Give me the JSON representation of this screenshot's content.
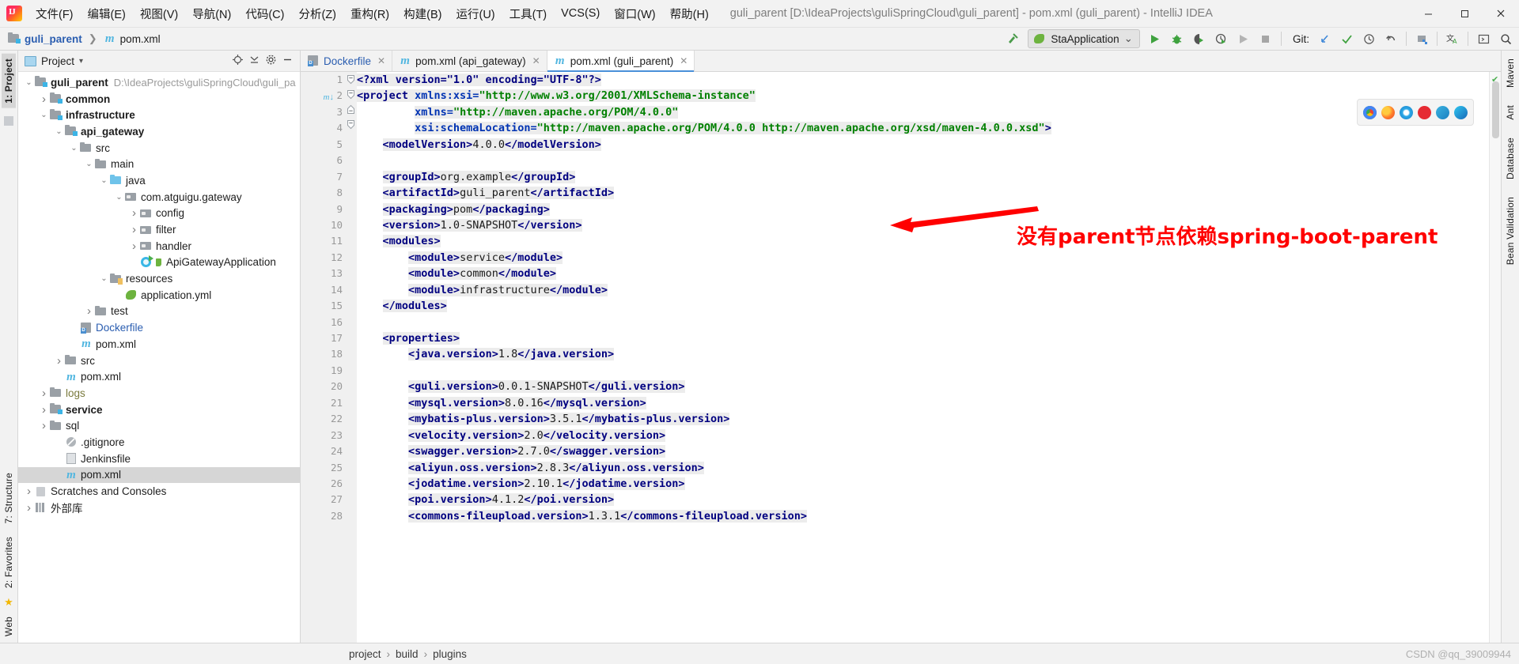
{
  "titlebar": {
    "logo_icon": "intellij-logo-icon",
    "menu": [
      {
        "label": "文件(F)"
      },
      {
        "label": "编辑(E)"
      },
      {
        "label": "视图(V)"
      },
      {
        "label": "导航(N)"
      },
      {
        "label": "代码(C)"
      },
      {
        "label": "分析(Z)"
      },
      {
        "label": "重构(R)"
      },
      {
        "label": "构建(B)"
      },
      {
        "label": "运行(U)"
      },
      {
        "label": "工具(T)"
      },
      {
        "label": "VCS(S)"
      },
      {
        "label": "窗口(W)"
      },
      {
        "label": "帮助(H)"
      }
    ],
    "window_title": "guli_parent [D:\\IdeaProjects\\guliSpringCloud\\guli_parent] - pom.xml (guli_parent) - IntelliJ IDEA",
    "minimize": "–",
    "maximize": "▢",
    "close": "✕"
  },
  "toolbar": {
    "breadcrumb_project": "guli_parent",
    "breadcrumb_sep": "❯",
    "breadcrumb_file": "pom.xml",
    "build_icon": "hammer-icon",
    "run_config": "StaApplication",
    "run_config_caret": "⌄",
    "run_icon": "run-icon",
    "debug_icon": "debug-icon",
    "run_coverage_icon": "run-with-coverage-icon",
    "profile_icon": "profiler-icon",
    "rerun_icon": "rerun-icon",
    "stop_icon": "stop-icon",
    "git_label": "Git:",
    "git_update_icon": "update-project-icon",
    "git_commit_icon": "commit-icon",
    "git_history_icon": "history-icon",
    "git_rollback_icon": "rollback-icon",
    "structure_icon": "select-in-icon",
    "translate_icon": "translate-icon",
    "terminal_icon": "terminal-icon",
    "search_icon": "search-everywhere-icon"
  },
  "left_strip": {
    "top_tabs": [
      {
        "label": "1: Project",
        "selected": true
      }
    ],
    "bottom_tabs": [
      {
        "label": "7: Structure"
      },
      {
        "label": "2: Favorites"
      }
    ],
    "web_tab": "Web",
    "star_icon": "favorites-star-icon"
  },
  "right_strip": {
    "tabs": [
      {
        "label": "Maven"
      },
      {
        "label": "Ant"
      },
      {
        "label": "Database"
      },
      {
        "label": "Bean Validation"
      }
    ]
  },
  "project_panel": {
    "header_title": "Project",
    "header_caret": "▾",
    "locate_icon": "locate-file-icon",
    "collapse_icon": "collapse-all-icon",
    "settings_icon": "gear-icon",
    "hide_icon": "hide-panel-icon",
    "tree": [
      {
        "label": "guli_parent",
        "sub": "D:\\IdeaProjects\\guliSpringCloud\\guli_pa",
        "indent": 0,
        "arrow": "▾",
        "icon": "module-icon",
        "bold": true
      },
      {
        "label": "common",
        "indent": 1,
        "arrow": "▸",
        "icon": "module-icon",
        "bold": true
      },
      {
        "label": "infrastructure",
        "indent": 1,
        "arrow": "▾",
        "icon": "module-icon",
        "bold": true
      },
      {
        "label": "api_gateway",
        "indent": 2,
        "arrow": "▾",
        "icon": "module-icon",
        "bold": true
      },
      {
        "label": "src",
        "indent": 3,
        "arrow": "▾",
        "icon": "folder-icon"
      },
      {
        "label": "main",
        "indent": 4,
        "arrow": "▾",
        "icon": "folder-icon"
      },
      {
        "label": "java",
        "indent": 5,
        "arrow": "▾",
        "icon": "source-root-icon"
      },
      {
        "label": "com.atguigu.gateway",
        "indent": 6,
        "arrow": "▾",
        "icon": "package-icon"
      },
      {
        "label": "config",
        "indent": 7,
        "arrow": "▸",
        "icon": "package-icon"
      },
      {
        "label": "filter",
        "indent": 7,
        "arrow": "▸",
        "icon": "package-icon"
      },
      {
        "label": "handler",
        "indent": 7,
        "arrow": "▸",
        "icon": "package-icon"
      },
      {
        "label": "ApiGatewayApplication",
        "indent": 7,
        "arrow": "",
        "icon": "spring-boot-class-icon"
      },
      {
        "label": "resources",
        "indent": 5,
        "arrow": "▾",
        "icon": "resources-root-icon"
      },
      {
        "label": "application.yml",
        "indent": 6,
        "arrow": "",
        "icon": "spring-yaml-icon"
      },
      {
        "label": "test",
        "indent": 4,
        "arrow": "▸",
        "icon": "folder-icon"
      },
      {
        "label": "Dockerfile",
        "indent": 3,
        "arrow": "",
        "icon": "dockerfile-icon",
        "link": true
      },
      {
        "label": "pom.xml",
        "indent": 3,
        "arrow": "",
        "icon": "maven-icon"
      },
      {
        "label": "src",
        "indent": 2,
        "arrow": "▸",
        "icon": "folder-icon"
      },
      {
        "label": "pom.xml",
        "indent": 2,
        "arrow": "",
        "icon": "maven-icon"
      },
      {
        "label": "logs",
        "indent": 1,
        "arrow": "▸",
        "icon": "folder-icon",
        "olive": true
      },
      {
        "label": "service",
        "indent": 1,
        "arrow": "▸",
        "icon": "module-icon",
        "bold": true
      },
      {
        "label": "sql",
        "indent": 1,
        "arrow": "▸",
        "icon": "folder-icon"
      },
      {
        "label": ".gitignore",
        "indent": 2,
        "arrow": "",
        "icon": "gitignore-icon"
      },
      {
        "label": "Jenkinsfile",
        "indent": 2,
        "arrow": "",
        "icon": "file-icon"
      },
      {
        "label": "pom.xml",
        "indent": 2,
        "arrow": "",
        "icon": "maven-icon",
        "selected": true
      },
      {
        "label": "Scratches and Consoles",
        "indent": 0,
        "arrow": "▸",
        "icon": "scratches-icon"
      },
      {
        "label": "外部库",
        "indent": 0,
        "arrow": "▸",
        "icon": "library-icon"
      }
    ]
  },
  "editor": {
    "tabs": [
      {
        "label": "Dockerfile",
        "icon": "dockerfile-icon",
        "close": "✕",
        "active": false,
        "link": true
      },
      {
        "label": "pom.xml (api_gateway)",
        "icon": "maven-icon",
        "close": "✕",
        "active": false
      },
      {
        "label": "pom.xml (guli_parent)",
        "icon": "maven-icon",
        "close": "✕",
        "active": true
      }
    ],
    "first_line": 1,
    "lines": [
      {
        "n": 1,
        "fold": "",
        "mark": "",
        "segs": [
          {
            "t": "<?xml version=\"1.0\" encoding=\"UTF-8\"?>",
            "c": "pi",
            "hl": true
          }
        ]
      },
      {
        "n": 2,
        "fold": "open",
        "mark": "m↓",
        "segs": [
          {
            "t": "<project ",
            "c": "tag"
          },
          {
            "t": "xmlns:xsi=",
            "c": "attrname"
          },
          {
            "t": "\"http://www.w3.org/2001/XMLSchema-instance\"",
            "c": "str"
          }
        ],
        "hl": true
      },
      {
        "n": 3,
        "fold": "",
        "mark": "",
        "segs": [
          {
            "t": "         ",
            "c": "txt"
          },
          {
            "t": "xmlns=",
            "c": "attrname"
          },
          {
            "t": "\"http://maven.apache.org/POM/4.0.0\"",
            "c": "str"
          }
        ],
        "hl": true
      },
      {
        "n": 4,
        "fold": "",
        "mark": "",
        "segs": [
          {
            "t": "         ",
            "c": "txt"
          },
          {
            "t": "xsi:schemaLocation=",
            "c": "attrname"
          },
          {
            "t": "\"http://maven.apache.org/POM/4.0.0 http://maven.apache.org/xsd/maven-4.0.0.xsd\"",
            "c": "str"
          },
          {
            "t": ">",
            "c": "tag"
          }
        ],
        "hl": true
      },
      {
        "n": 5,
        "fold": "",
        "mark": "",
        "segs": [
          {
            "t": "    ",
            "c": "txt"
          },
          {
            "t": "<modelVersion>",
            "c": "tag"
          },
          {
            "t": "4.0.0",
            "c": "txt"
          },
          {
            "t": "</modelVersion>",
            "c": "tag"
          }
        ],
        "hl": true
      },
      {
        "n": 6,
        "fold": "",
        "mark": "",
        "segs": []
      },
      {
        "n": 7,
        "fold": "",
        "mark": "",
        "segs": [
          {
            "t": "    ",
            "c": "txt"
          },
          {
            "t": "<groupId>",
            "c": "tag"
          },
          {
            "t": "org.example",
            "c": "txt"
          },
          {
            "t": "</groupId>",
            "c": "tag"
          }
        ],
        "hl": true
      },
      {
        "n": 8,
        "fold": "",
        "mark": "",
        "segs": [
          {
            "t": "    ",
            "c": "txt"
          },
          {
            "t": "<artifactId>",
            "c": "tag"
          },
          {
            "t": "guli_parent",
            "c": "txt"
          },
          {
            "t": "</artifactId>",
            "c": "tag"
          }
        ],
        "hl": true
      },
      {
        "n": 9,
        "fold": "",
        "mark": "",
        "segs": [
          {
            "t": "    ",
            "c": "txt"
          },
          {
            "t": "<packaging>",
            "c": "tag"
          },
          {
            "t": "pom",
            "c": "txt"
          },
          {
            "t": "</packaging>",
            "c": "tag"
          }
        ],
        "hl": true
      },
      {
        "n": 10,
        "fold": "",
        "mark": "",
        "segs": [
          {
            "t": "    ",
            "c": "txt"
          },
          {
            "t": "<version>",
            "c": "tag"
          },
          {
            "t": "1.0-SNAPSHOT",
            "c": "txt"
          },
          {
            "t": "</version>",
            "c": "tag"
          }
        ],
        "hl": true
      },
      {
        "n": 11,
        "fold": "open",
        "mark": "",
        "segs": [
          {
            "t": "    ",
            "c": "txt"
          },
          {
            "t": "<modules>",
            "c": "tag"
          }
        ],
        "hl": true
      },
      {
        "n": 12,
        "fold": "",
        "mark": "",
        "segs": [
          {
            "t": "        ",
            "c": "txt"
          },
          {
            "t": "<module>",
            "c": "tag"
          },
          {
            "t": "service",
            "c": "txt"
          },
          {
            "t": "</module>",
            "c": "tag"
          }
        ],
        "hl": true
      },
      {
        "n": 13,
        "fold": "",
        "mark": "",
        "segs": [
          {
            "t": "        ",
            "c": "txt"
          },
          {
            "t": "<module>",
            "c": "tag"
          },
          {
            "t": "common",
            "c": "txt"
          },
          {
            "t": "</module>",
            "c": "tag"
          }
        ],
        "hl": true
      },
      {
        "n": 14,
        "fold": "",
        "mark": "",
        "segs": [
          {
            "t": "        ",
            "c": "txt"
          },
          {
            "t": "<module>",
            "c": "tag"
          },
          {
            "t": "infrastructure",
            "c": "txt"
          },
          {
            "t": "</module>",
            "c": "tag"
          }
        ],
        "hl": true
      },
      {
        "n": 15,
        "fold": "close",
        "mark": "",
        "segs": [
          {
            "t": "    ",
            "c": "txt"
          },
          {
            "t": "</modules>",
            "c": "tag"
          }
        ],
        "hl": true
      },
      {
        "n": 16,
        "fold": "",
        "mark": "",
        "segs": []
      },
      {
        "n": 17,
        "fold": "open",
        "mark": "",
        "segs": [
          {
            "t": "    ",
            "c": "txt"
          },
          {
            "t": "<properties>",
            "c": "tag"
          }
        ],
        "hl": true
      },
      {
        "n": 18,
        "fold": "",
        "mark": "",
        "segs": [
          {
            "t": "        ",
            "c": "txt"
          },
          {
            "t": "<java.version>",
            "c": "tag"
          },
          {
            "t": "1.8",
            "c": "txt"
          },
          {
            "t": "</java.version>",
            "c": "tag"
          }
        ],
        "hl": true
      },
      {
        "n": 19,
        "fold": "",
        "mark": "",
        "segs": []
      },
      {
        "n": 20,
        "fold": "",
        "mark": "",
        "segs": [
          {
            "t": "        ",
            "c": "txt"
          },
          {
            "t": "<guli.version>",
            "c": "tag"
          },
          {
            "t": "0.0.1-SNAPSHOT",
            "c": "txt"
          },
          {
            "t": "</guli.version>",
            "c": "tag"
          }
        ],
        "hl": true
      },
      {
        "n": 21,
        "fold": "",
        "mark": "",
        "segs": [
          {
            "t": "        ",
            "c": "txt"
          },
          {
            "t": "<mysql.version>",
            "c": "tag"
          },
          {
            "t": "8.0.16",
            "c": "txt"
          },
          {
            "t": "</mysql.version>",
            "c": "tag"
          }
        ],
        "hl": true
      },
      {
        "n": 22,
        "fold": "",
        "mark": "",
        "segs": [
          {
            "t": "        ",
            "c": "txt"
          },
          {
            "t": "<mybatis-plus.version>",
            "c": "tag"
          },
          {
            "t": "3.5.1",
            "c": "txt"
          },
          {
            "t": "</mybatis-plus.version>",
            "c": "tag"
          }
        ],
        "hl": true
      },
      {
        "n": 23,
        "fold": "",
        "mark": "",
        "segs": [
          {
            "t": "        ",
            "c": "txt"
          },
          {
            "t": "<velocity.version>",
            "c": "tag"
          },
          {
            "t": "2.0",
            "c": "txt"
          },
          {
            "t": "</velocity.version>",
            "c": "tag"
          }
        ],
        "hl": true
      },
      {
        "n": 24,
        "fold": "",
        "mark": "",
        "segs": [
          {
            "t": "        ",
            "c": "txt"
          },
          {
            "t": "<swagger.version>",
            "c": "tag"
          },
          {
            "t": "2.7.0",
            "c": "txt"
          },
          {
            "t": "</swagger.version>",
            "c": "tag"
          }
        ],
        "hl": true
      },
      {
        "n": 25,
        "fold": "",
        "mark": "",
        "segs": [
          {
            "t": "        ",
            "c": "txt"
          },
          {
            "t": "<aliyun.oss.version>",
            "c": "tag"
          },
          {
            "t": "2.8.3",
            "c": "txt"
          },
          {
            "t": "</aliyun.oss.version>",
            "c": "tag"
          }
        ],
        "hl": true
      },
      {
        "n": 26,
        "fold": "",
        "mark": "",
        "segs": [
          {
            "t": "        ",
            "c": "txt"
          },
          {
            "t": "<jodatime.version>",
            "c": "tag"
          },
          {
            "t": "2.10.1",
            "c": "txt"
          },
          {
            "t": "</jodatime.version>",
            "c": "tag"
          }
        ],
        "hl": true
      },
      {
        "n": 27,
        "fold": "",
        "mark": "",
        "segs": [
          {
            "t": "        ",
            "c": "txt"
          },
          {
            "t": "<poi.version>",
            "c": "tag"
          },
          {
            "t": "4.1.2",
            "c": "txt"
          },
          {
            "t": "</poi.version>",
            "c": "tag"
          }
        ],
        "hl": true
      },
      {
        "n": 28,
        "fold": "",
        "mark": "",
        "segs": [
          {
            "t": "        ",
            "c": "txt"
          },
          {
            "t": "<commons-fileupload.version>",
            "c": "tag"
          },
          {
            "t": "1.3.1",
            "c": "txt"
          },
          {
            "t": "</commons-fileupload.version>",
            "c": "tag"
          }
        ],
        "hl": true
      }
    ],
    "annotation_text": "没有parent节点依赖spring-boot-parent",
    "annotation_color": "#ff0000",
    "browser_icons": [
      "chrome-icon",
      "firefox-icon",
      "safari-icon",
      "opera-icon",
      "edge-legacy-icon",
      "edge-icon"
    ],
    "inspection_status": "no-errors-check-icon"
  },
  "statusbar": {
    "crumbs": [
      "project",
      "build",
      "plugins"
    ],
    "crumb_sep": "›",
    "watermark": "CSDN @qq_39009944"
  }
}
